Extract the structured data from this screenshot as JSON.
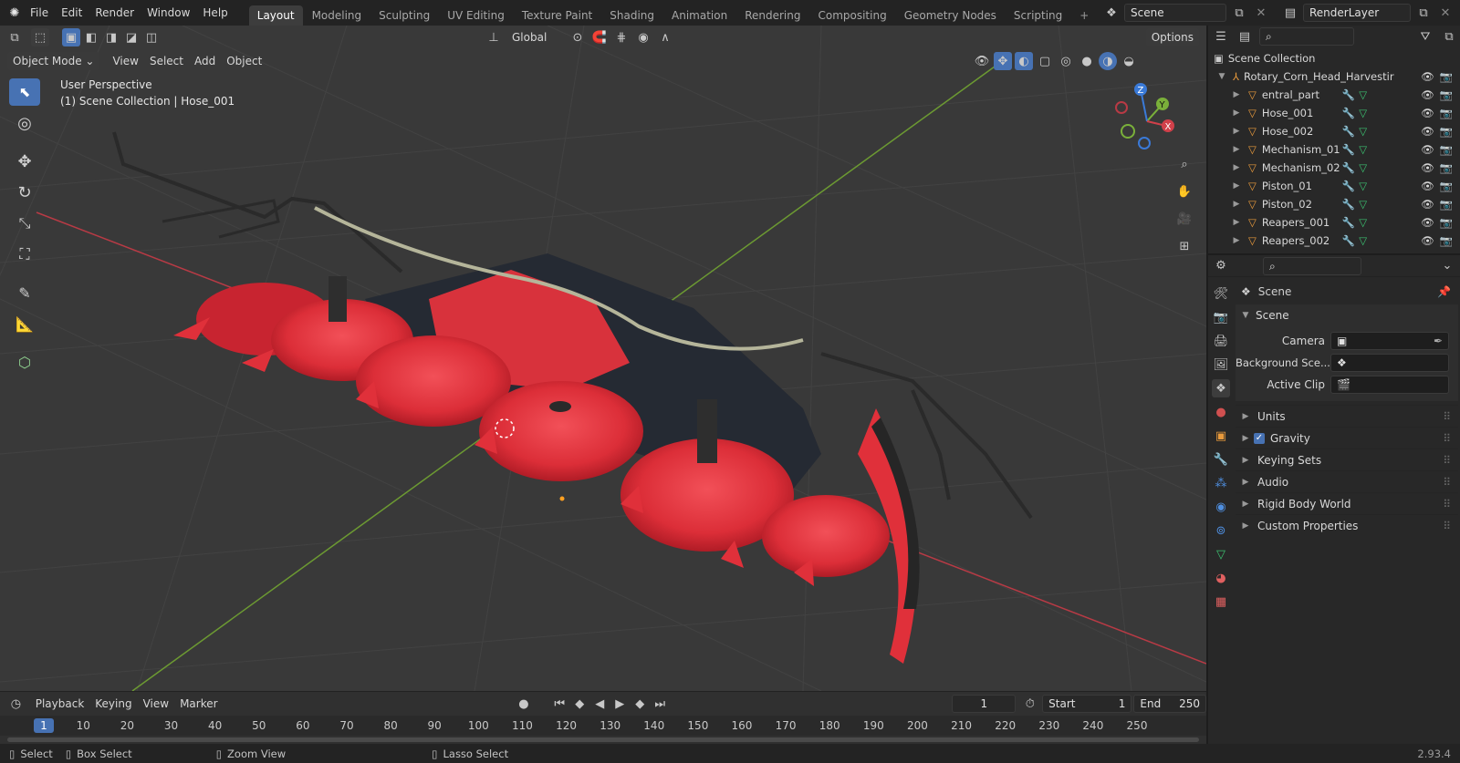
{
  "topbar": {
    "menus": [
      "File",
      "Edit",
      "Render",
      "Window",
      "Help"
    ],
    "workspace_tabs": [
      "Layout",
      "Modeling",
      "Sculpting",
      "UV Editing",
      "Texture Paint",
      "Shading",
      "Animation",
      "Rendering",
      "Compositing",
      "Geometry Nodes",
      "Scripting"
    ],
    "active_tab": "Layout",
    "scene_name": "Scene",
    "view_layer": "RenderLayer"
  },
  "viewport_header": {
    "mode": "Object Mode",
    "menus": [
      "View",
      "Select",
      "Add",
      "Object"
    ],
    "transform_orientation": "Global",
    "options_label": "Options"
  },
  "viewport": {
    "perspective": "User Perspective",
    "context": "(1) Scene Collection | Hose_001"
  },
  "outliner": {
    "root": "Scene Collection",
    "parent": "Rotary_Corn_Head_Harvestir",
    "items": [
      "entral_part",
      "Hose_001",
      "Hose_002",
      "Mechanism_01",
      "Mechanism_02",
      "Piston_01",
      "Piston_02",
      "Reapers_001",
      "Reapers_002"
    ],
    "active_item": "Hose_001"
  },
  "properties": {
    "context_title": "Scene",
    "panel_title": "Scene",
    "fields": [
      {
        "label": "Camera",
        "value": ""
      },
      {
        "label": "Background Sce...",
        "value": ""
      },
      {
        "label": "Active Clip",
        "value": ""
      }
    ],
    "sections": [
      "Units",
      "Gravity",
      "Keying Sets",
      "Audio",
      "Rigid Body World",
      "Custom Properties"
    ],
    "gravity_checked": true
  },
  "timeline": {
    "menus": [
      "Playback",
      "Keying",
      "View",
      "Marker"
    ],
    "current_frame": "1",
    "start_label": "Start",
    "start": "1",
    "end_label": "End",
    "end": "250",
    "ruler": [
      "1",
      "10",
      "20",
      "30",
      "40",
      "50",
      "60",
      "70",
      "80",
      "90",
      "100",
      "110",
      "120",
      "130",
      "140",
      "150",
      "160",
      "170",
      "180",
      "190",
      "200",
      "210",
      "220",
      "230",
      "240",
      "250"
    ]
  },
  "statusbar": {
    "hints": [
      "Select",
      "Box Select",
      "Zoom View",
      "Lasso Select"
    ],
    "version": "2.93.4"
  },
  "colors": {
    "accent": "#4772b3",
    "model_red": "#e0303a",
    "axis_x": "#d1404a",
    "axis_y": "#7ab03a",
    "axis_z": "#3a7ad8"
  }
}
